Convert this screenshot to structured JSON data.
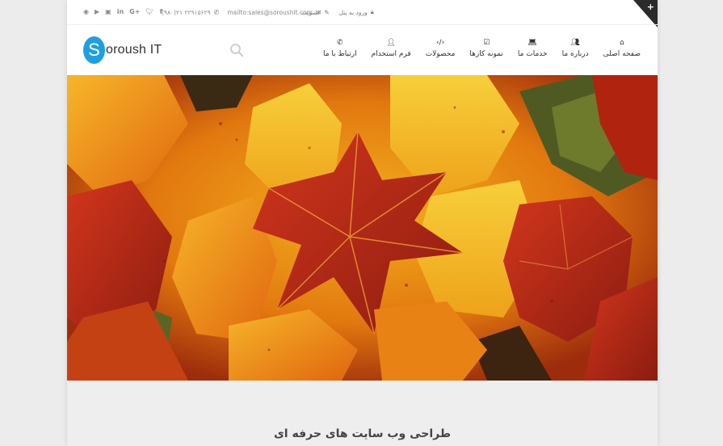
{
  "topbar": {
    "login_label": "ورود به پنل",
    "signup_label": "عضویت",
    "email": "mailto:sales@soroushit.com",
    "phone": "(۹۸۰)۲۱ ۲۲۹۱۵۶۲۹",
    "social_icons": [
      "rss-icon",
      "youtube-icon",
      "instagram-icon",
      "linkedin-icon",
      "google-plus-icon",
      "twitter-icon",
      "facebook-icon"
    ],
    "corner_symbol": "+"
  },
  "brand": {
    "logo_letter": "S",
    "logo_text": "oroush IT",
    "accent_color": "#1f9fe0"
  },
  "nav": {
    "items": [
      {
        "label": "صفحه اصلی",
        "icon": "home-icon"
      },
      {
        "label": "درباره ما",
        "icon": "users-icon"
      },
      {
        "label": "خدمات ما",
        "icon": "laptop-icon"
      },
      {
        "label": "نمونه کارها",
        "icon": "check-square-icon"
      },
      {
        "label": "محصولات",
        "icon": "code-icon"
      },
      {
        "label": "فرم استخدام",
        "icon": "user-plus-icon"
      },
      {
        "label": "ارتباط با ما",
        "icon": "phone-icon"
      }
    ]
  },
  "section": {
    "title": "طراحی وب سایت های حرفه ای"
  }
}
